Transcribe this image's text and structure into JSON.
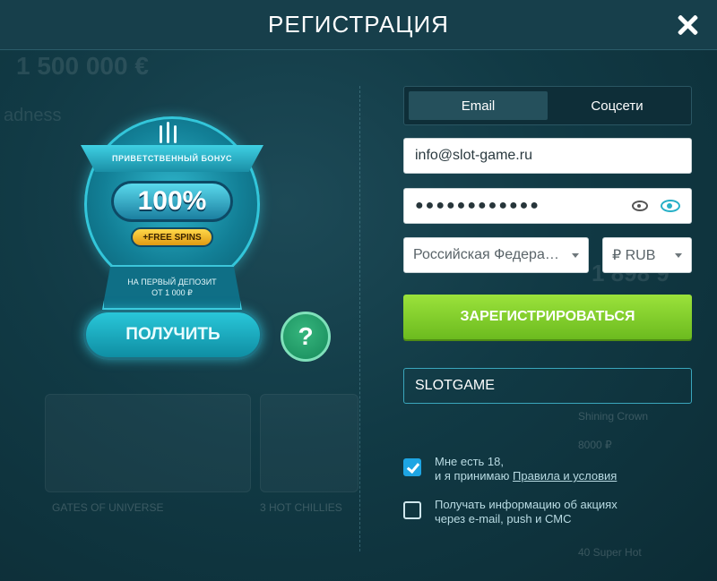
{
  "header": {
    "title": "РЕГИСТРАЦИЯ",
    "close_icon": "close-icon"
  },
  "background": {
    "jackpot_text": "1 500 000 €",
    "game_name_partial": "adness",
    "number_partial": "1 898 9",
    "game_tiles": [
      "GATES OF UNIVERSE",
      "3 HOT CHILLIES",
      "Shining Crown",
      "40 Super Hot"
    ],
    "tile_amount": "8000 ₽"
  },
  "bonus": {
    "ribbon_label": "ПРИВЕТСТВЕННЫЙ БОНУС",
    "percent": "100%",
    "spins": "+FREE SPINS",
    "deposit_line1": "НА ПЕРВЫЙ ДЕПОЗИТ",
    "deposit_line2": "ОТ 1 000 ₽",
    "get_button": "ПОЛУЧИТЬ",
    "help_button": "?"
  },
  "form": {
    "tabs": [
      {
        "label": "Email",
        "active": true
      },
      {
        "label": "Соцсети",
        "active": false
      }
    ],
    "email_value": "info@slot-game.ru",
    "password_mask": "●●●●●●●●●●●●",
    "country_value": "Российская Федерация",
    "currency_value": "₽ RUB",
    "register_button": "ЗАРЕГИСТРИРОВАТЬСЯ",
    "promo_code": "SLOTGAME",
    "age_check": {
      "checked": true,
      "line1": "Мне есть 18,",
      "line2_prefix": "и я принимаю ",
      "terms_link": "Правила и условия"
    },
    "news_check": {
      "checked": false,
      "line1": "Получать информацию об акциях",
      "line2": "через e-mail, push и СМС"
    }
  },
  "colors": {
    "register_green": "#8ed431",
    "accent_teal": "#27b0c7",
    "checkbox_blue": "#1ea5e3"
  }
}
